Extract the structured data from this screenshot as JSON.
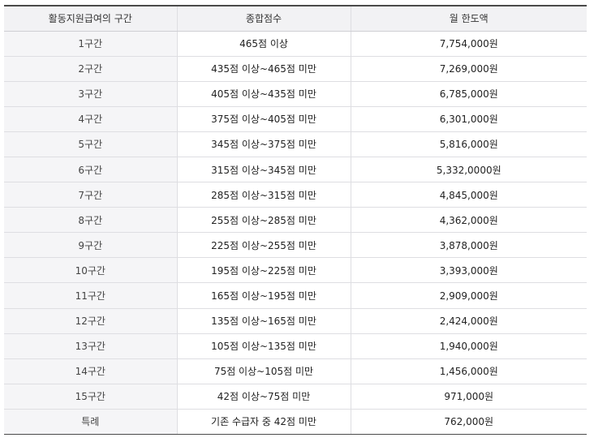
{
  "table": {
    "headers": [
      "활동지원급여의 구간",
      "종합점수",
      "월 한도액"
    ],
    "rows": [
      [
        "1구간",
        "465점 이상",
        "7,754,000원"
      ],
      [
        "2구간",
        "435점 이상~465점 미만",
        "7,269,000원"
      ],
      [
        "3구간",
        "405점 이상~435점 미만",
        "6,785,000원"
      ],
      [
        "4구간",
        "375점 이상~405점 미만",
        "6,301,000원"
      ],
      [
        "5구간",
        "345점 이상~375점 미만",
        "5,816,000원"
      ],
      [
        "6구간",
        "315점 이상~345점 미만",
        "5,332,0000원"
      ],
      [
        "7구간",
        "285점 이상~315점 미만",
        "4,845,000원"
      ],
      [
        "8구간",
        "255점 이상~285점 미만",
        "4,362,000원"
      ],
      [
        "9구간",
        "225점 이상~255점 미만",
        "3,878,000원"
      ],
      [
        "10구간",
        "195점 이상~225점 미만",
        "3,393,000원"
      ],
      [
        "11구간",
        "165점 이상~195점 미만",
        "2,909,000원"
      ],
      [
        "12구간",
        "135점 이상~165점 미만",
        "2,424,000원"
      ],
      [
        "13구간",
        "105점 이상~135점 미만",
        "1,940,000원"
      ],
      [
        "14구간",
        "75점 이상~105점 미만",
        "1,456,000원"
      ],
      [
        "15구간",
        "42점 이상~75점 미만",
        "971,000원"
      ],
      [
        "특례",
        "기존 수급자 중 42점 미만",
        "762,000원"
      ]
    ]
  }
}
